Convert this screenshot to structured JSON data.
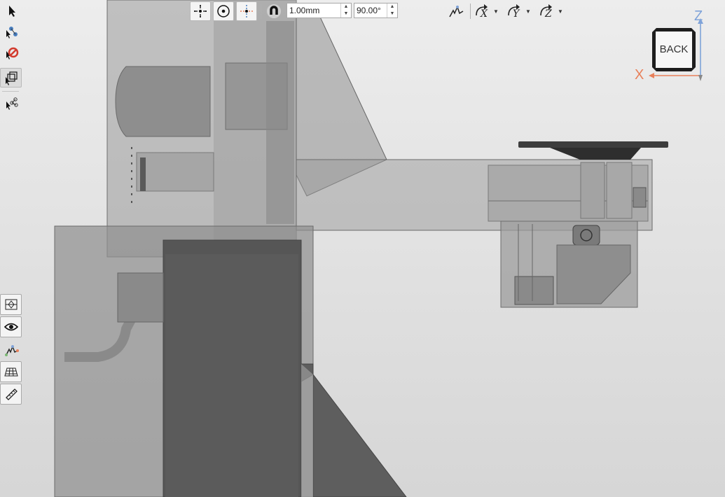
{
  "toolbar": {
    "linear_step": "1.00mm",
    "angle_step": "90.00°",
    "buttons": [
      "move-free-icon",
      "move-center-icon",
      "move-axis-icon",
      "snap-magnet-icon"
    ],
    "axis_buttons": [
      "orient-icon",
      "rotate-x-icon",
      "rotate-y-icon",
      "rotate-z-icon"
    ]
  },
  "left_tools": [
    "select-arrow-icon",
    "select-vertex-icon",
    "deselect-icon",
    "select-box-icon",
    "select-group-icon"
  ],
  "view_tools": [
    "section-view-icon",
    "visibility-eye-icon",
    "orientation-icon",
    "grid-icon",
    "measure-ruler-icon"
  ],
  "view_cube": {
    "face": "BACK",
    "axis_x": "X",
    "axis_z": "Z",
    "colors": {
      "x": "#e8805a",
      "z": "#7fa3d9"
    }
  }
}
